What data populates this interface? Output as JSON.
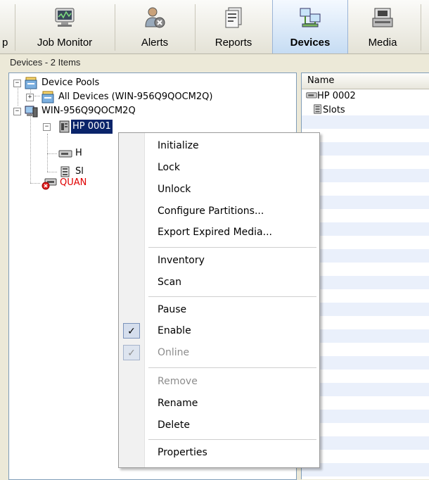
{
  "toolbar": {
    "items": [
      {
        "label": "p",
        "icon": "backup-icon"
      },
      {
        "label": "Job Monitor",
        "icon": "job-monitor-icon"
      },
      {
        "label": "Alerts",
        "icon": "alerts-icon"
      },
      {
        "label": "Reports",
        "icon": "reports-icon"
      },
      {
        "label": "Devices",
        "icon": "devices-icon",
        "active": true
      },
      {
        "label": "Media",
        "icon": "media-icon"
      }
    ]
  },
  "status": {
    "text": "Devices - 2 Items"
  },
  "tree": {
    "device_pools": "Device Pools",
    "all_devices": "All Devices (WIN-956Q9QOCM2Q)",
    "server": "WIN-956Q9QOCM2Q",
    "hp0001": "HP 0001",
    "child_h": "H",
    "child_sl": "Sl",
    "quantum": "QUAN"
  },
  "list": {
    "header_name": "Name",
    "rows": [
      "HP 0002",
      "Slots"
    ]
  },
  "context_menu": {
    "initialize": "Initialize",
    "lock": "Lock",
    "unlock": "Unlock",
    "configure_partitions": "Configure Partitions...",
    "export_expired_media": "Export Expired Media...",
    "inventory": "Inventory",
    "scan": "Scan",
    "pause": "Pause",
    "enable": "Enable",
    "online": "Online",
    "remove": "Remove",
    "rename": "Rename",
    "delete": "Delete",
    "properties": "Properties",
    "enable_checked": true,
    "online_checked": true,
    "online_disabled": true,
    "remove_disabled": true
  },
  "colors": {
    "selection": "#0a246a",
    "error_text": "#e00000",
    "active_tab": "#c6dcf3"
  }
}
